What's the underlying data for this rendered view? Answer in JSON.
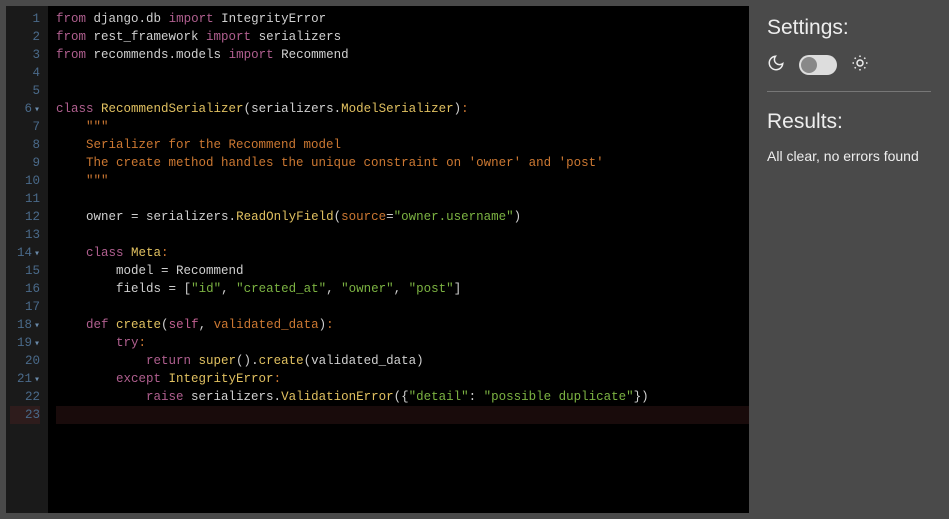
{
  "sidebar": {
    "settings_heading": "Settings:",
    "results_heading": "Results:",
    "results_text": "All clear, no errors found"
  },
  "editor": {
    "active_line": 23,
    "fold_lines": [
      6,
      14,
      18,
      19,
      21
    ],
    "lines": [
      [
        [
          "kw",
          "from"
        ],
        [
          "name",
          " django"
        ],
        [
          "op",
          "."
        ],
        [
          "name",
          "db "
        ],
        [
          "kw",
          "import"
        ],
        [
          "name",
          " IntegrityError"
        ]
      ],
      [
        [
          "kw",
          "from"
        ],
        [
          "name",
          " rest_framework "
        ],
        [
          "kw",
          "import"
        ],
        [
          "name",
          " serializers"
        ]
      ],
      [
        [
          "kw",
          "from"
        ],
        [
          "name",
          " recommends"
        ],
        [
          "op",
          "."
        ],
        [
          "name",
          "models "
        ],
        [
          "kw",
          "import"
        ],
        [
          "name",
          " Recommend"
        ]
      ],
      [],
      [],
      [
        [
          "kw",
          "class "
        ],
        [
          "cls",
          "RecommendSerializer"
        ],
        [
          "op",
          "("
        ],
        [
          "name",
          "serializers"
        ],
        [
          "op",
          "."
        ],
        [
          "cls",
          "ModelSerializer"
        ],
        [
          "op",
          ")"
        ],
        [
          "punc",
          ":"
        ]
      ],
      [
        [
          "name",
          "    "
        ],
        [
          "dstr",
          "\"\"\""
        ]
      ],
      [
        [
          "name",
          "    "
        ],
        [
          "dstr",
          "Serializer for the Recommend model"
        ]
      ],
      [
        [
          "name",
          "    "
        ],
        [
          "dstr",
          "The create method handles the unique constraint on 'owner' and 'post'"
        ]
      ],
      [
        [
          "name",
          "    "
        ],
        [
          "dstr",
          "\"\"\""
        ]
      ],
      [],
      [
        [
          "name",
          "    owner "
        ],
        [
          "op",
          "="
        ],
        [
          "name",
          " serializers"
        ],
        [
          "op",
          "."
        ],
        [
          "fn",
          "ReadOnlyField"
        ],
        [
          "op",
          "("
        ],
        [
          "arg",
          "source"
        ],
        [
          "op",
          "="
        ],
        [
          "str",
          "\"owner.username\""
        ],
        [
          "op",
          ")"
        ]
      ],
      [],
      [
        [
          "name",
          "    "
        ],
        [
          "kw",
          "class "
        ],
        [
          "cls",
          "Meta"
        ],
        [
          "punc",
          ":"
        ]
      ],
      [
        [
          "name",
          "        model "
        ],
        [
          "op",
          "="
        ],
        [
          "name",
          " Recommend"
        ]
      ],
      [
        [
          "name",
          "        fields "
        ],
        [
          "op",
          "="
        ],
        [
          "name",
          " "
        ],
        [
          "op",
          "["
        ],
        [
          "str",
          "\"id\""
        ],
        [
          "op",
          ", "
        ],
        [
          "str",
          "\"created_at\""
        ],
        [
          "op",
          ", "
        ],
        [
          "str",
          "\"owner\""
        ],
        [
          "op",
          ", "
        ],
        [
          "str",
          "\"post\""
        ],
        [
          "op",
          "]"
        ]
      ],
      [],
      [
        [
          "name",
          "    "
        ],
        [
          "kw",
          "def "
        ],
        [
          "fn",
          "create"
        ],
        [
          "op",
          "("
        ],
        [
          "self",
          "self"
        ],
        [
          "op",
          ", "
        ],
        [
          "arg",
          "validated_data"
        ],
        [
          "op",
          ")"
        ],
        [
          "punc",
          ":"
        ]
      ],
      [
        [
          "name",
          "        "
        ],
        [
          "kw",
          "try"
        ],
        [
          "punc",
          ":"
        ]
      ],
      [
        [
          "name",
          "            "
        ],
        [
          "kw",
          "return "
        ],
        [
          "fn",
          "super"
        ],
        [
          "op",
          "()"
        ],
        [
          "op",
          "."
        ],
        [
          "fn",
          "create"
        ],
        [
          "op",
          "("
        ],
        [
          "name",
          "validated_data"
        ],
        [
          "op",
          ")"
        ]
      ],
      [
        [
          "name",
          "        "
        ],
        [
          "kw",
          "except "
        ],
        [
          "cls",
          "IntegrityError"
        ],
        [
          "punc",
          ":"
        ]
      ],
      [
        [
          "name",
          "            "
        ],
        [
          "kw",
          "raise "
        ],
        [
          "name",
          "serializers"
        ],
        [
          "op",
          "."
        ],
        [
          "cls",
          "ValidationError"
        ],
        [
          "op",
          "({"
        ],
        [
          "str",
          "\"detail\""
        ],
        [
          "op",
          ": "
        ],
        [
          "str",
          "\"possible duplicate\""
        ],
        [
          "op",
          "})"
        ]
      ],
      []
    ]
  }
}
